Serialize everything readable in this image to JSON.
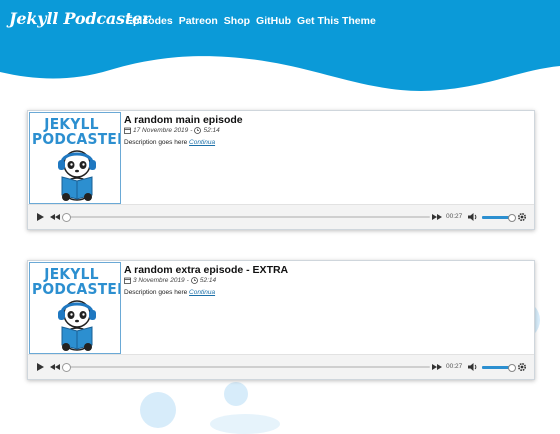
{
  "header": {
    "brand": "Jekyll Podcaster",
    "nav": [
      "Episodes",
      "Patreon",
      "Shop",
      "GitHub",
      "Get This Theme"
    ]
  },
  "colors": {
    "accent": "#0b9ad8",
    "cover_title": "#2c8fd0",
    "link": "#1a6fa8"
  },
  "episodes": [
    {
      "cover_title": "JEKYLL PODCASTER",
      "title": "A random main episode",
      "date": "17 Novembre 2019",
      "duration": "52:14",
      "description": "Description goes here",
      "more_link": "Continua",
      "player": {
        "current_time": "00:27",
        "progress": 0.0,
        "volume": 0.9
      }
    },
    {
      "cover_title": "JEKYLL PODCASTER",
      "title": "A random extra episode - EXTRA",
      "date": "3 Novembre 2019",
      "duration": "52:14",
      "description": "Description goes here",
      "more_link": "Continua",
      "player": {
        "current_time": "00:27",
        "progress": 0.0,
        "volume": 0.9
      }
    }
  ],
  "icons": {
    "calendar": "calendar-icon",
    "clock": "clock-icon",
    "play": "play-icon",
    "rewind": "rewind-icon",
    "forward": "fast-forward-icon",
    "volume": "volume-icon",
    "settings": "gear-icon"
  }
}
